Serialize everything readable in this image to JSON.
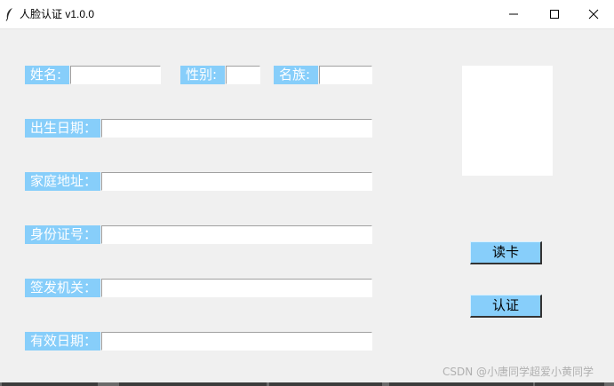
{
  "window": {
    "title": "人脸认证 v1.0.0",
    "controls": {
      "minimize": "minimize",
      "maximize": "maximize",
      "close": "close"
    }
  },
  "form": {
    "name_label": "姓名:",
    "gender_label": "性别:",
    "ethnicity_label": "名族:",
    "birthdate_label": "出生日期：",
    "address_label": "家庭地址：",
    "id_number_label": "身份证号：",
    "issuer_label": "签发机关：",
    "validity_label": "有效日期：",
    "name_value": "",
    "gender_value": "",
    "ethnicity_value": "",
    "birthdate_value": "",
    "address_value": "",
    "id_number_value": "",
    "issuer_value": "",
    "validity_value": ""
  },
  "buttons": {
    "read_card": "读卡",
    "verify": "认证"
  },
  "watermark": "CSDN @小唐同学超爱小黄同学",
  "colors": {
    "label_bg": "#87cefa",
    "label_text": "#ffffff",
    "button_bg": "#87cefa",
    "window_bg": "#f0f0f0"
  },
  "icons": [
    "feather-icon",
    "minimize-icon",
    "maximize-icon",
    "close-icon"
  ]
}
